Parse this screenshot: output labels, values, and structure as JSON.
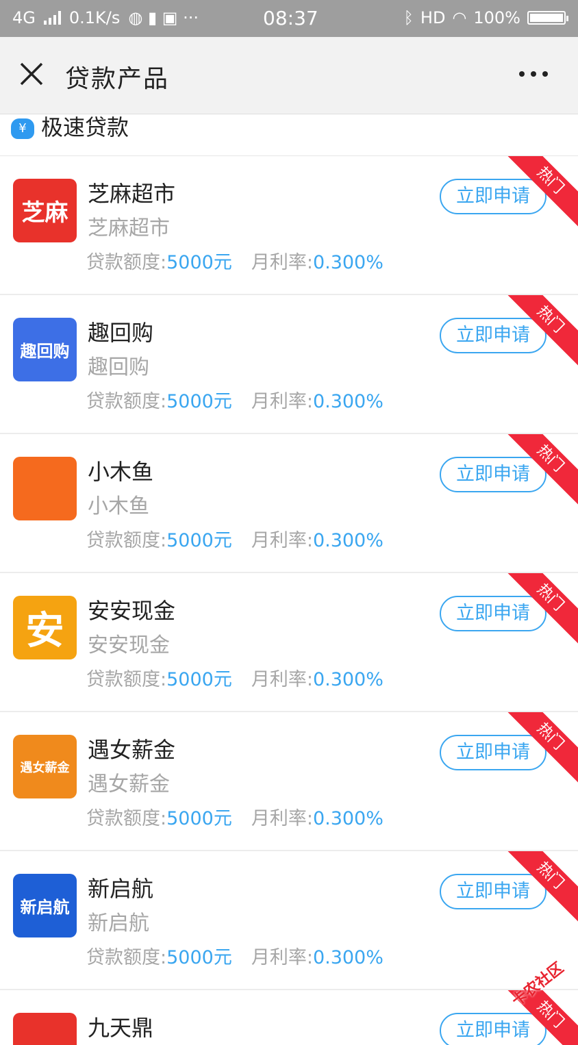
{
  "status": {
    "network": "4G",
    "speed": "0.1K/s",
    "time": "08:37",
    "hd": "HD",
    "battery": "100%"
  },
  "nav": {
    "title": "贷款产品"
  },
  "section": {
    "title": "极速贷款",
    "icon_text": "¥"
  },
  "labels": {
    "amount_label": "贷款额度:",
    "rate_label": "月利率:",
    "apply": "立即申请",
    "hot": "热门"
  },
  "products": [
    {
      "name": "芝麻超市",
      "subtitle": "芝麻超市",
      "amount": "5000元",
      "rate": "0.300%",
      "logo_text": "芝麻",
      "logo_color": "#e8322b"
    },
    {
      "name": "趣回购",
      "subtitle": "趣回购",
      "amount": "5000元",
      "rate": "0.300%",
      "logo_text": "趣回购",
      "logo_color": "#3d6fe6"
    },
    {
      "name": "小木鱼",
      "subtitle": "小木鱼",
      "amount": "5000元",
      "rate": "0.300%",
      "logo_text": "",
      "logo_color": "#f56a1e"
    },
    {
      "name": "安安现金",
      "subtitle": "安安现金",
      "amount": "5000元",
      "rate": "0.300%",
      "logo_text": "安",
      "logo_color": "#f5a311"
    },
    {
      "name": "遇女薪金",
      "subtitle": "遇女薪金",
      "amount": "5000元",
      "rate": "0.300%",
      "logo_text": "遇女薪金",
      "logo_color": "#f08a1c"
    },
    {
      "name": "新启航",
      "subtitle": "新启航",
      "amount": "5000元",
      "rate": "0.300%",
      "logo_text": "新启航",
      "logo_color": "#1e5fd6"
    },
    {
      "name": "九天鼎",
      "subtitle": "",
      "amount": "",
      "rate": "",
      "logo_text": "",
      "logo_color": "#e8322b"
    }
  ],
  "watermark": "卡农社区"
}
